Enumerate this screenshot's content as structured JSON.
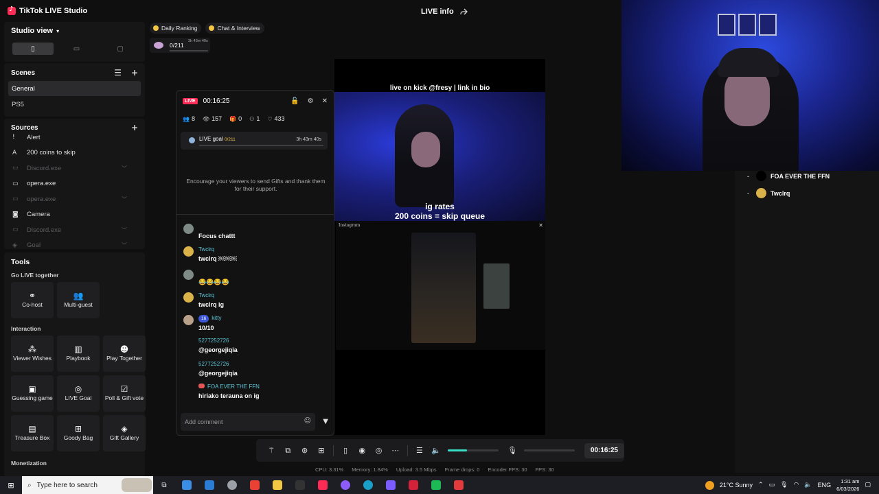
{
  "app": {
    "title": "TikTok LIVE Studio",
    "live_info": "LIVE info"
  },
  "studio": {
    "view_label": "Studio view",
    "view_modes": [
      "▯",
      "▭",
      "▢"
    ]
  },
  "scenes": {
    "title": "Scenes",
    "items": [
      "General",
      "PS5"
    ]
  },
  "sources": {
    "title": "Sources",
    "items": [
      {
        "label": "Alert",
        "icon": "alert-icon",
        "dim": false
      },
      {
        "label": "200 coins to skip",
        "icon": "text-icon",
        "dim": false
      },
      {
        "label": "Discord.exe",
        "icon": "window-icon",
        "dim": true
      },
      {
        "label": "opera.exe",
        "icon": "window-icon",
        "dim": false
      },
      {
        "label": "opera.exe",
        "icon": "window-icon",
        "dim": true
      },
      {
        "label": "Camera",
        "icon": "camera-icon",
        "dim": false
      },
      {
        "label": "Discord.exe",
        "icon": "window-icon",
        "dim": true
      },
      {
        "label": "Goal",
        "icon": "goal-icon",
        "dim": true
      }
    ]
  },
  "tools": {
    "title": "Tools",
    "go_live_together": "Go LIVE together",
    "together": [
      "Co-host",
      "Multi-guest"
    ],
    "interaction": "Interaction",
    "interaction_items": [
      "Viewer Wishes",
      "Playbook",
      "Play Together",
      "Guessing game",
      "LIVE Goal",
      "Poll & Gift vote",
      "Treasure Box",
      "Goody Bag",
      "Gift Gallery"
    ],
    "monetization": "Monetization"
  },
  "badges": {
    "ranking": "Daily Ranking",
    "chat": "Chat & Interview"
  },
  "mini_goal": {
    "value": "0/211",
    "time": "3h 43m 40s"
  },
  "preview": {
    "caption_top": "live on kick @fresy | link in bio",
    "caption_bottom_1": "ig rates",
    "caption_bottom_2": "200 coins = skip queue",
    "ig_label": "Instagram"
  },
  "chat": {
    "live_badge": "LIVE",
    "timer": "00:16:25",
    "stats": {
      "members": "8",
      "viewers": "157",
      "gifts": "0",
      "new_followers": "1",
      "likes": "433"
    },
    "goal_label": "LIVE goal",
    "goal_value": "0/211",
    "goal_time": "3h 43m 40s",
    "encourage": "Encourage your viewers to send Gifts and thank them for their support.",
    "messages": [
      {
        "name": "ﾠ",
        "text": "Focus chattt",
        "avatar": "#7d8a86",
        "level": ""
      },
      {
        "name": "Twclrq",
        "text": "twclrq ￼￼￼",
        "avatar": "#d9b24a",
        "level": ""
      },
      {
        "name": "ﾠ",
        "text": "😂😂😂😂",
        "avatar": "#7d8a86",
        "level": ""
      },
      {
        "name": "Twclrq",
        "text": "twclrq ig",
        "avatar": "#d9b24a",
        "level": ""
      },
      {
        "name": "kitty",
        "text": "10/10",
        "avatar": "#b9a08a",
        "level": "16"
      },
      {
        "name": "5277252726",
        "text": "@georgejiqia",
        "avatar": "#121213",
        "level": ""
      },
      {
        "name": "5277252726",
        "text": "@georgejiqia",
        "avatar": "#121213",
        "level": ""
      },
      {
        "name": "FOA EVER THE FFN",
        "text": "hiriako terauna on ig",
        "avatar": "#121213",
        "level": "heart"
      }
    ],
    "comment_placeholder": "Add comment"
  },
  "right_list": [
    {
      "name": "FOA EVER THE FFN",
      "avatar": "#000000"
    },
    {
      "name": "Twclrq",
      "avatar": "#d9b24a"
    }
  ],
  "controls": {
    "timer": "00:16:25",
    "volume_fraction": 0.37,
    "mic_fraction": 0.0
  },
  "status": {
    "cpu": "CPU: 3.31%",
    "memory": "Memory: 1.84%",
    "upload": "Upload: 3.5 Mbps",
    "frame_drops": "Frame drops: 0",
    "encoder_fps": "Encoder FPS: 30",
    "fps": "FPS: 30"
  },
  "taskbar": {
    "search_placeholder": "Type here to search",
    "weather": "21°C  Sunny",
    "lang": "ENG",
    "time": "1:31 am",
    "date": "6/03/2026",
    "apps": [
      "#3a8ee6",
      "#2b7cd3",
      "#9aa0a6",
      "#e94235",
      "#f2c744",
      "#333333",
      "#fe2c55",
      "#8b5cf6",
      "#1aa0c8",
      "#7a5cff",
      "#d4223b",
      "#1db954",
      "#e33b3b"
    ]
  }
}
